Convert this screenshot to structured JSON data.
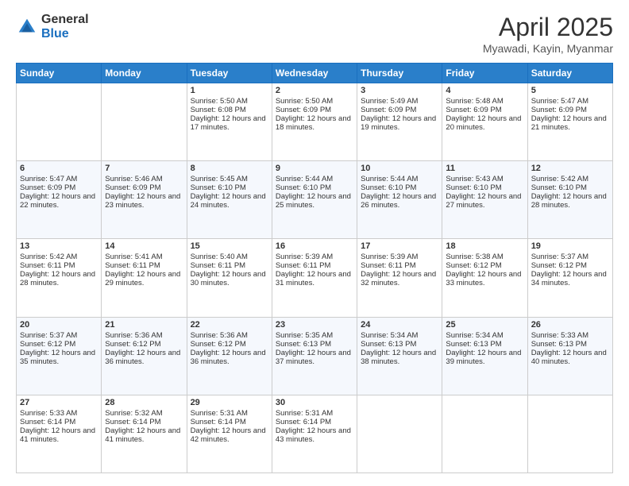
{
  "logo": {
    "general": "General",
    "blue": "Blue"
  },
  "header": {
    "title": "April 2025",
    "subtitle": "Myawadi, Kayin, Myanmar"
  },
  "weekdays": [
    "Sunday",
    "Monday",
    "Tuesday",
    "Wednesday",
    "Thursday",
    "Friday",
    "Saturday"
  ],
  "weeks": [
    [
      {
        "day": "",
        "empty": true
      },
      {
        "day": "",
        "empty": true
      },
      {
        "day": "1",
        "sunrise": "Sunrise: 5:50 AM",
        "sunset": "Sunset: 6:08 PM",
        "daylight": "Daylight: 12 hours and 17 minutes."
      },
      {
        "day": "2",
        "sunrise": "Sunrise: 5:50 AM",
        "sunset": "Sunset: 6:09 PM",
        "daylight": "Daylight: 12 hours and 18 minutes."
      },
      {
        "day": "3",
        "sunrise": "Sunrise: 5:49 AM",
        "sunset": "Sunset: 6:09 PM",
        "daylight": "Daylight: 12 hours and 19 minutes."
      },
      {
        "day": "4",
        "sunrise": "Sunrise: 5:48 AM",
        "sunset": "Sunset: 6:09 PM",
        "daylight": "Daylight: 12 hours and 20 minutes."
      },
      {
        "day": "5",
        "sunrise": "Sunrise: 5:47 AM",
        "sunset": "Sunset: 6:09 PM",
        "daylight": "Daylight: 12 hours and 21 minutes."
      }
    ],
    [
      {
        "day": "6",
        "sunrise": "Sunrise: 5:47 AM",
        "sunset": "Sunset: 6:09 PM",
        "daylight": "Daylight: 12 hours and 22 minutes."
      },
      {
        "day": "7",
        "sunrise": "Sunrise: 5:46 AM",
        "sunset": "Sunset: 6:09 PM",
        "daylight": "Daylight: 12 hours and 23 minutes."
      },
      {
        "day": "8",
        "sunrise": "Sunrise: 5:45 AM",
        "sunset": "Sunset: 6:10 PM",
        "daylight": "Daylight: 12 hours and 24 minutes."
      },
      {
        "day": "9",
        "sunrise": "Sunrise: 5:44 AM",
        "sunset": "Sunset: 6:10 PM",
        "daylight": "Daylight: 12 hours and 25 minutes."
      },
      {
        "day": "10",
        "sunrise": "Sunrise: 5:44 AM",
        "sunset": "Sunset: 6:10 PM",
        "daylight": "Daylight: 12 hours and 26 minutes."
      },
      {
        "day": "11",
        "sunrise": "Sunrise: 5:43 AM",
        "sunset": "Sunset: 6:10 PM",
        "daylight": "Daylight: 12 hours and 27 minutes."
      },
      {
        "day": "12",
        "sunrise": "Sunrise: 5:42 AM",
        "sunset": "Sunset: 6:10 PM",
        "daylight": "Daylight: 12 hours and 28 minutes."
      }
    ],
    [
      {
        "day": "13",
        "sunrise": "Sunrise: 5:42 AM",
        "sunset": "Sunset: 6:11 PM",
        "daylight": "Daylight: 12 hours and 28 minutes."
      },
      {
        "day": "14",
        "sunrise": "Sunrise: 5:41 AM",
        "sunset": "Sunset: 6:11 PM",
        "daylight": "Daylight: 12 hours and 29 minutes."
      },
      {
        "day": "15",
        "sunrise": "Sunrise: 5:40 AM",
        "sunset": "Sunset: 6:11 PM",
        "daylight": "Daylight: 12 hours and 30 minutes."
      },
      {
        "day": "16",
        "sunrise": "Sunrise: 5:39 AM",
        "sunset": "Sunset: 6:11 PM",
        "daylight": "Daylight: 12 hours and 31 minutes."
      },
      {
        "day": "17",
        "sunrise": "Sunrise: 5:39 AM",
        "sunset": "Sunset: 6:11 PM",
        "daylight": "Daylight: 12 hours and 32 minutes."
      },
      {
        "day": "18",
        "sunrise": "Sunrise: 5:38 AM",
        "sunset": "Sunset: 6:12 PM",
        "daylight": "Daylight: 12 hours and 33 minutes."
      },
      {
        "day": "19",
        "sunrise": "Sunrise: 5:37 AM",
        "sunset": "Sunset: 6:12 PM",
        "daylight": "Daylight: 12 hours and 34 minutes."
      }
    ],
    [
      {
        "day": "20",
        "sunrise": "Sunrise: 5:37 AM",
        "sunset": "Sunset: 6:12 PM",
        "daylight": "Daylight: 12 hours and 35 minutes."
      },
      {
        "day": "21",
        "sunrise": "Sunrise: 5:36 AM",
        "sunset": "Sunset: 6:12 PM",
        "daylight": "Daylight: 12 hours and 36 minutes."
      },
      {
        "day": "22",
        "sunrise": "Sunrise: 5:36 AM",
        "sunset": "Sunset: 6:12 PM",
        "daylight": "Daylight: 12 hours and 36 minutes."
      },
      {
        "day": "23",
        "sunrise": "Sunrise: 5:35 AM",
        "sunset": "Sunset: 6:13 PM",
        "daylight": "Daylight: 12 hours and 37 minutes."
      },
      {
        "day": "24",
        "sunrise": "Sunrise: 5:34 AM",
        "sunset": "Sunset: 6:13 PM",
        "daylight": "Daylight: 12 hours and 38 minutes."
      },
      {
        "day": "25",
        "sunrise": "Sunrise: 5:34 AM",
        "sunset": "Sunset: 6:13 PM",
        "daylight": "Daylight: 12 hours and 39 minutes."
      },
      {
        "day": "26",
        "sunrise": "Sunrise: 5:33 AM",
        "sunset": "Sunset: 6:13 PM",
        "daylight": "Daylight: 12 hours and 40 minutes."
      }
    ],
    [
      {
        "day": "27",
        "sunrise": "Sunrise: 5:33 AM",
        "sunset": "Sunset: 6:14 PM",
        "daylight": "Daylight: 12 hours and 41 minutes."
      },
      {
        "day": "28",
        "sunrise": "Sunrise: 5:32 AM",
        "sunset": "Sunset: 6:14 PM",
        "daylight": "Daylight: 12 hours and 41 minutes."
      },
      {
        "day": "29",
        "sunrise": "Sunrise: 5:31 AM",
        "sunset": "Sunset: 6:14 PM",
        "daylight": "Daylight: 12 hours and 42 minutes."
      },
      {
        "day": "30",
        "sunrise": "Sunrise: 5:31 AM",
        "sunset": "Sunset: 6:14 PM",
        "daylight": "Daylight: 12 hours and 43 minutes."
      },
      {
        "day": "",
        "empty": true
      },
      {
        "day": "",
        "empty": true
      },
      {
        "day": "",
        "empty": true
      }
    ]
  ]
}
